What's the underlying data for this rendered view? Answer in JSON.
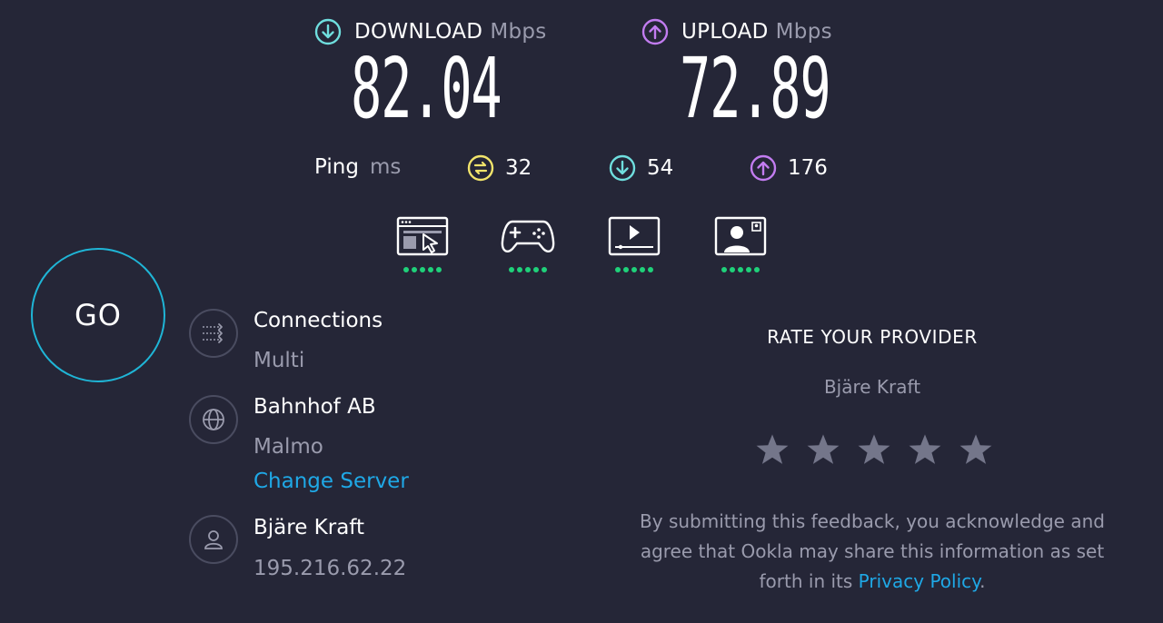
{
  "download": {
    "label": "DOWNLOAD",
    "unit": "Mbps",
    "value": "82.04"
  },
  "upload": {
    "label": "UPLOAD",
    "unit": "Mbps",
    "value": "72.89"
  },
  "ping": {
    "label": "Ping",
    "unit": "ms",
    "idle": "32",
    "download": "54",
    "upload": "176"
  },
  "features": [
    {
      "icon": "web-browsing-icon",
      "rating": 5
    },
    {
      "icon": "gaming-icon",
      "rating": 5
    },
    {
      "icon": "video-streaming-icon",
      "rating": 5
    },
    {
      "icon": "video-chat-icon",
      "rating": 5
    }
  ],
  "go_label": "GO",
  "connections": {
    "title": "Connections",
    "value": "Multi"
  },
  "server": {
    "name": "Bahnhof AB",
    "location": "Malmo",
    "change_label": "Change Server"
  },
  "provider": {
    "name": "Bjäre Kraft",
    "ip": "195.216.62.22"
  },
  "rate": {
    "title": "RATE YOUR PROVIDER",
    "provider": "Bjäre Kraft",
    "stars": 5,
    "disclaimer_line1": "By submitting this feedback, you acknowledge and",
    "disclaimer_line2": "agree that Ookla may share this information as set",
    "disclaimer_line3_pre": "forth in its",
    "privacy_label": "Privacy Policy",
    "disclaimer_end": "."
  },
  "colors": {
    "background": "#252637",
    "download_accent": "#6fdede",
    "upload_accent": "#c27cf0",
    "ping_accent": "#f2e46b",
    "go_ring": "#1fb5d6",
    "rating_dots": "#1fd17a",
    "link": "#1fa8e6",
    "star": "#74768a"
  }
}
